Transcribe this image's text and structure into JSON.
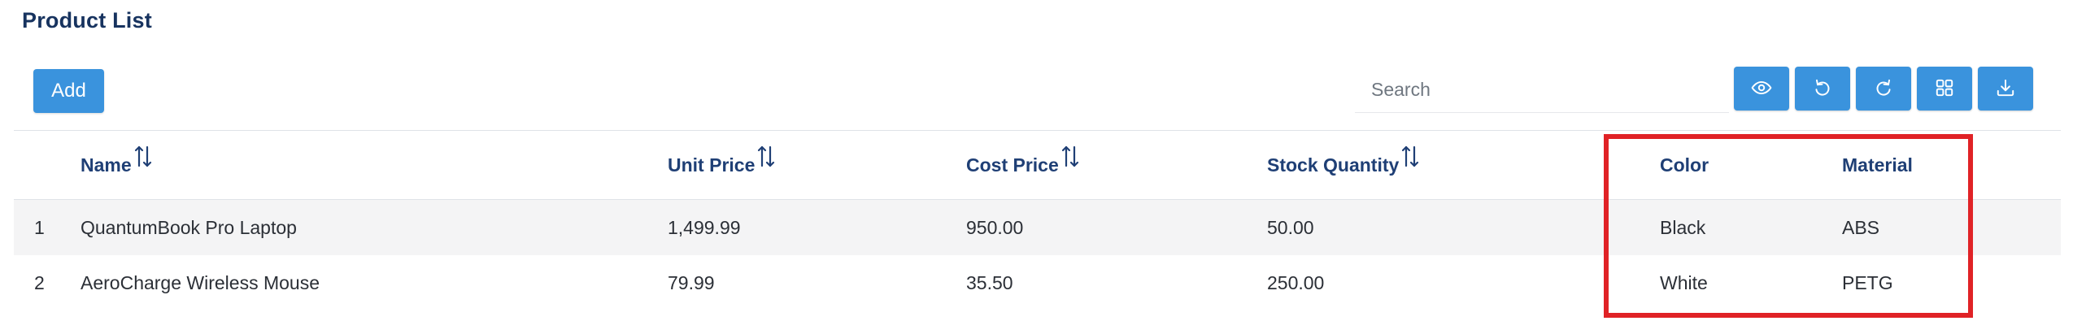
{
  "page": {
    "title": "Product List"
  },
  "toolbar": {
    "add_label": "Add",
    "search_placeholder": "Search",
    "search_value": "",
    "accent_color": "#3a93dd",
    "icons": [
      "eye-icon",
      "undo-icon",
      "redo-icon",
      "grid-icon",
      "download-icon"
    ]
  },
  "table": {
    "columns": [
      {
        "key": "name",
        "label": "Name",
        "sortable": true
      },
      {
        "key": "unit_price",
        "label": "Unit Price",
        "sortable": true
      },
      {
        "key": "cost_price",
        "label": "Cost Price",
        "sortable": true
      },
      {
        "key": "stock_quantity",
        "label": "Stock Quantity",
        "sortable": true
      },
      {
        "key": "color",
        "label": "Color",
        "sortable": false
      },
      {
        "key": "material",
        "label": "Material",
        "sortable": false
      }
    ],
    "rows": [
      {
        "index": "1",
        "name": "QuantumBook Pro Laptop",
        "unit_price": "1,499.99",
        "cost_price": "950.00",
        "stock_quantity": "50.00",
        "color": "Black",
        "material": "ABS"
      },
      {
        "index": "2",
        "name": "AeroCharge Wireless Mouse",
        "unit_price": "79.99",
        "cost_price": "35.50",
        "stock_quantity": "250.00",
        "color": "White",
        "material": "PETG"
      }
    ]
  },
  "highlight": {
    "color": "#e02226",
    "columns": [
      "color",
      "material"
    ]
  }
}
